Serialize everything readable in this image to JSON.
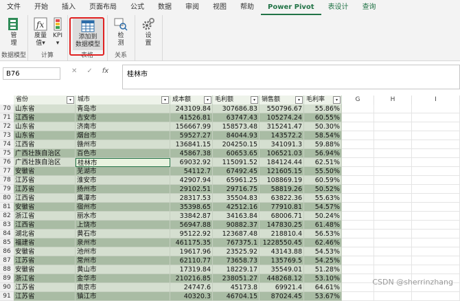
{
  "tabs": [
    "文件",
    "开始",
    "插入",
    "页面布局",
    "公式",
    "数据",
    "审阅",
    "视图",
    "帮助",
    "Power Pivot",
    "表设计",
    "查询"
  ],
  "ribbon": {
    "manage_label": "管\n理",
    "manage_group": "数据模型",
    "measures_label": "度量\n值▾",
    "kpi_label": "KPI\n▾",
    "calc_group": "计算",
    "add_model_label": "添加到\n数据模型",
    "table_group": "表格",
    "detect_label": "检\n测",
    "relations_group": "关系",
    "settings_label": "设\n置"
  },
  "formula": {
    "namebox": "B76",
    "content": "桂林市"
  },
  "headers": [
    "省份",
    "城市",
    "成本额",
    "毛利额",
    "销售额",
    "毛利率"
  ],
  "extra_cols": [
    "G",
    "H",
    "I"
  ],
  "rows": [
    {
      "n": "70",
      "p": "山东省",
      "c": "青岛市",
      "cost": "243109.84",
      "profit": "307686.83",
      "sales": "550796.67",
      "rate": "55.86%"
    },
    {
      "n": "71",
      "p": "江西省",
      "c": "吉安市",
      "cost": "41526.81",
      "profit": "63747.43",
      "sales": "105274.24",
      "rate": "60.55%"
    },
    {
      "n": "72",
      "p": "山东省",
      "c": "济南市",
      "cost": "156667.99",
      "profit": "158573.48",
      "sales": "315241.47",
      "rate": "50.30%"
    },
    {
      "n": "73",
      "p": "山东省",
      "c": "烟台市",
      "cost": "59527.27",
      "profit": "84044.93",
      "sales": "143572.2",
      "rate": "58.54%"
    },
    {
      "n": "74",
      "p": "江西省",
      "c": "赣州市",
      "cost": "136841.15",
      "profit": "204250.15",
      "sales": "341091.3",
      "rate": "59.88%"
    },
    {
      "n": "75",
      "p": "广西壮族自治区",
      "c": "百色市",
      "cost": "45867.38",
      "profit": "60653.65",
      "sales": "106521.03",
      "rate": "56.94%"
    },
    {
      "n": "76",
      "p": "广西壮族自治区",
      "c": "桂林市",
      "cost": "69032.92",
      "profit": "115091.52",
      "sales": "184124.44",
      "rate": "62.51%"
    },
    {
      "n": "77",
      "p": "安徽省",
      "c": "芜湖市",
      "cost": "54112.7",
      "profit": "67492.45",
      "sales": "121605.15",
      "rate": "55.50%"
    },
    {
      "n": "78",
      "p": "江苏省",
      "c": "淮安市",
      "cost": "42907.94",
      "profit": "65961.25",
      "sales": "108869.19",
      "rate": "60.59%"
    },
    {
      "n": "79",
      "p": "江苏省",
      "c": "扬州市",
      "cost": "29102.51",
      "profit": "29716.75",
      "sales": "58819.26",
      "rate": "50.52%"
    },
    {
      "n": "80",
      "p": "江西省",
      "c": "鹰潭市",
      "cost": "28317.53",
      "profit": "35504.83",
      "sales": "63822.36",
      "rate": "55.63%"
    },
    {
      "n": "81",
      "p": "安徽省",
      "c": "宿州市",
      "cost": "35398.65",
      "profit": "42512.16",
      "sales": "77910.81",
      "rate": "54.57%"
    },
    {
      "n": "82",
      "p": "浙江省",
      "c": "丽水市",
      "cost": "33842.87",
      "profit": "34163.84",
      "sales": "68006.71",
      "rate": "50.24%"
    },
    {
      "n": "83",
      "p": "江西省",
      "c": "上饶市",
      "cost": "56947.88",
      "profit": "90882.37",
      "sales": "147830.25",
      "rate": "61.48%"
    },
    {
      "n": "84",
      "p": "湖北省",
      "c": "黄石市",
      "cost": "95122.92",
      "profit": "123687.48",
      "sales": "218810.4",
      "rate": "56.53%"
    },
    {
      "n": "85",
      "p": "福建省",
      "c": "泉州市",
      "cost": "461175.35",
      "profit": "767375.1",
      "sales": "1228550.45",
      "rate": "62.46%"
    },
    {
      "n": "86",
      "p": "安徽省",
      "c": "池州市",
      "cost": "19617.96",
      "profit": "23525.92",
      "sales": "43143.88",
      "rate": "54.53%"
    },
    {
      "n": "87",
      "p": "江苏省",
      "c": "常州市",
      "cost": "62110.77",
      "profit": "73658.73",
      "sales": "135769.5",
      "rate": "54.25%"
    },
    {
      "n": "88",
      "p": "安徽省",
      "c": "黄山市",
      "cost": "17319.84",
      "profit": "18229.17",
      "sales": "35549.01",
      "rate": "51.28%"
    },
    {
      "n": "89",
      "p": "浙江省",
      "c": "金华市",
      "cost": "210216.85",
      "profit": "238051.27",
      "sales": "448268.12",
      "rate": "53.10%"
    },
    {
      "n": "90",
      "p": "江苏省",
      "c": "南京市",
      "cost": "24747.6",
      "profit": "45173.8",
      "sales": "69921.4",
      "rate": "64.61%"
    },
    {
      "n": "91",
      "p": "江苏省",
      "c": "镇江市",
      "cost": "40320.3",
      "profit": "46704.15",
      "sales": "87024.45",
      "rate": "53.67%"
    }
  ],
  "colors": {
    "band_a": "#d5dfd0",
    "band_b": "#a9bca4",
    "selected": "#e8f3df",
    "accent": "#217346"
  },
  "watermark": "CSDN @sherrinzhang"
}
